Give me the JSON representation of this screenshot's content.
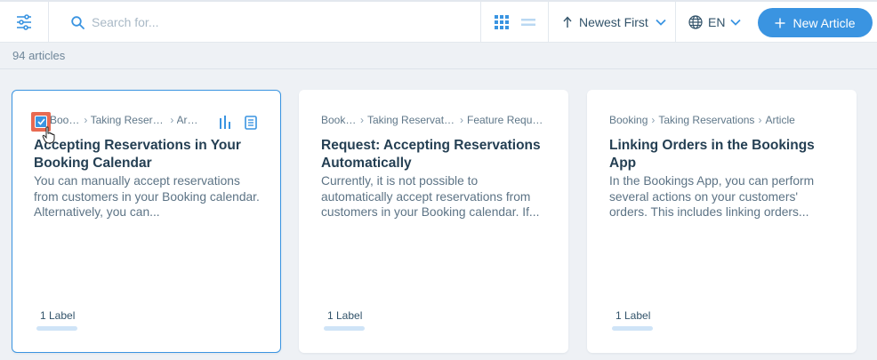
{
  "toolbar": {
    "search_placeholder": "Search for...",
    "sort_label": "Newest First",
    "language": "EN",
    "new_article_label": "New Article",
    "accent_color": "#3a94e1"
  },
  "summary": {
    "count_text": "94 articles"
  },
  "cards": [
    {
      "crumb1": "Booking",
      "crumb2": "Taking Reservations",
      "crumb3": "Article",
      "title": "Accepting Reservations in Your Booking Calendar",
      "description": "You can manually accept reservations from customers in your Booking calendar. Alternatively, you can...",
      "labels": "1 Label",
      "selected": true
    },
    {
      "crumb1": "Booking",
      "crumb2": "Taking Reservations",
      "crumb3": "Feature Request",
      "title": "Request: Accepting Reservations Automatically",
      "description": "Currently, it is not possible to automatically accept reservations from customers in your Booking calendar. If...",
      "labels": "1 Label",
      "selected": false
    },
    {
      "crumb1": "Booking",
      "crumb2": "Taking Reservations",
      "crumb3": "Article",
      "title": "Linking Orders in the Bookings App",
      "description": "In the Bookings App, you can perform several actions on your customers' orders. This includes linking orders...",
      "labels": "1 Label",
      "selected": false
    }
  ]
}
